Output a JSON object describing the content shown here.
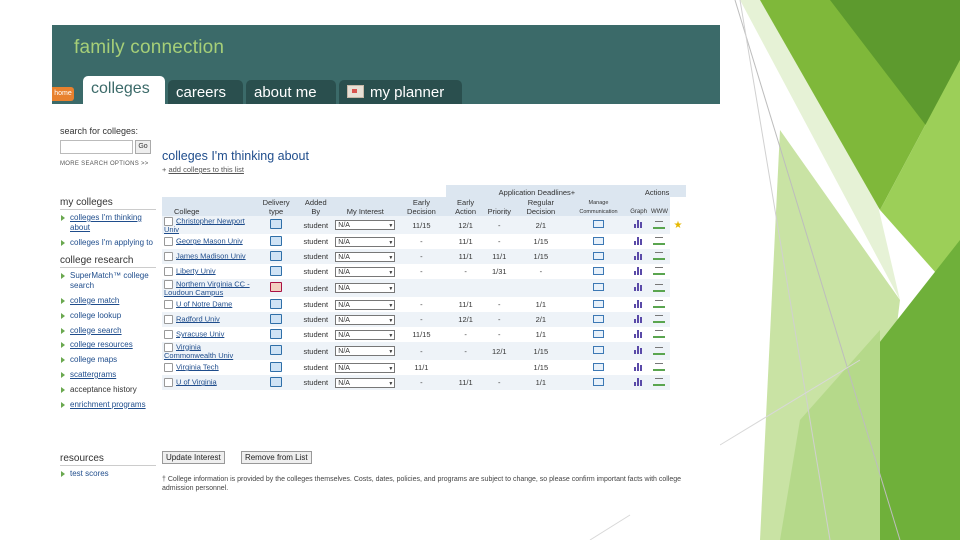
{
  "app": {
    "brand": "family connection",
    "home_tab": "home"
  },
  "tabs": [
    {
      "label": "colleges",
      "active": true
    },
    {
      "label": "careers",
      "active": false
    },
    {
      "label": "about me",
      "active": false
    },
    {
      "label": "my planner",
      "active": false
    }
  ],
  "sidebar": {
    "search_label": "search for colleges:",
    "search_placeholder": "",
    "go_label": "Go",
    "more_options": "MORE SEARCH OPTIONS >>",
    "my_colleges": {
      "heading": "my colleges",
      "items": [
        {
          "label": "colleges I'm thinking about"
        },
        {
          "label": "colleges I'm applying to"
        }
      ]
    },
    "research": {
      "heading": "college research",
      "items": [
        {
          "label": "SuperMatch™ college search"
        },
        {
          "label": "college match"
        },
        {
          "label": "college lookup"
        },
        {
          "label": "college search"
        },
        {
          "label": "college resources"
        },
        {
          "label": "college maps"
        },
        {
          "label": "scattergrams"
        },
        {
          "label": "acceptance history"
        },
        {
          "label": "enrichment programs"
        }
      ]
    },
    "resources": {
      "heading": "resources",
      "items": [
        {
          "label": "test scores"
        }
      ]
    }
  },
  "main": {
    "heading": "colleges I'm thinking about",
    "add_link": "add colleges to this list",
    "group_headers": {
      "deadlines": "Application Deadlines+",
      "actions": "Actions"
    },
    "columns": {
      "college": "College",
      "delivery": "Delivery type",
      "added_by": "Added By",
      "interest": "My Interest",
      "early_decision": "Early Decision",
      "early_action": "Early Action",
      "priority": "Priority",
      "regular": "Regular Decision",
      "manage": "Manage Communication",
      "graph": "Graph",
      "www": "WWW"
    },
    "rows": [
      {
        "college": "Christopher Newport Univ",
        "delivery": "web",
        "added_by": "student",
        "interest": "N/A",
        "ed": "11/15",
        "ea": "12/1",
        "pr": "-",
        "rd": "2/1",
        "star": true
      },
      {
        "college": "George Mason Univ",
        "delivery": "web",
        "added_by": "student",
        "interest": "N/A",
        "ed": "-",
        "ea": "11/1",
        "pr": "-",
        "rd": "1/15",
        "star": false
      },
      {
        "college": "James Madison Univ",
        "delivery": "web",
        "added_by": "student",
        "interest": "N/A",
        "ed": "-",
        "ea": "11/1",
        "pr": "11/1",
        "rd": "1/15",
        "star": false
      },
      {
        "college": "Liberty Univ",
        "delivery": "web",
        "added_by": "student",
        "interest": "N/A",
        "ed": "-",
        "ea": "-",
        "pr": "1/31",
        "rd": "-",
        "star": false
      },
      {
        "college": "Northern Virginia CC - Loudoun Campus",
        "delivery": "paper",
        "added_by": "student",
        "interest": "N/A",
        "ed": "",
        "ea": "",
        "pr": "",
        "rd": "",
        "star": false
      },
      {
        "college": "U of Notre Dame",
        "delivery": "web",
        "added_by": "student",
        "interest": "N/A",
        "ed": "-",
        "ea": "11/1",
        "pr": "-",
        "rd": "1/1",
        "star": false
      },
      {
        "college": "Radford Univ",
        "delivery": "web",
        "added_by": "student",
        "interest": "N/A",
        "ed": "-",
        "ea": "12/1",
        "pr": "-",
        "rd": "2/1",
        "star": false
      },
      {
        "college": "Syracuse Univ",
        "delivery": "web",
        "added_by": "student",
        "interest": "N/A",
        "ed": "11/15",
        "ea": "-",
        "pr": "-",
        "rd": "1/1",
        "star": false
      },
      {
        "college": "Virginia Commonwealth Univ",
        "delivery": "web",
        "added_by": "student",
        "interest": "N/A",
        "ed": "-",
        "ea": "-",
        "pr": "12/1",
        "rd": "1/15",
        "star": false
      },
      {
        "college": "Virginia Tech",
        "delivery": "web",
        "added_by": "student",
        "interest": "N/A",
        "ed": "11/1",
        "ea": "",
        "pr": "",
        "rd": "1/15",
        "star": false
      },
      {
        "college": "U of Virginia",
        "delivery": "web",
        "added_by": "student",
        "interest": "N/A",
        "ed": "-",
        "ea": "11/1",
        "pr": "-",
        "rd": "1/1",
        "star": false
      }
    ],
    "buttons": {
      "update": "Update Interest",
      "remove": "Remove from List"
    },
    "note": "† College information is provided by the colleges themselves. Costs, dates, policies, and programs are subject to change, so please confirm important facts with college admission personnel."
  },
  "colors": {
    "topbar": "#3b6a69",
    "brand": "#a6cf78",
    "tab_dark": "#2a4f4e",
    "link": "#1f4d8c",
    "home": "#e8812e",
    "green_deco": "#8cc63f"
  }
}
